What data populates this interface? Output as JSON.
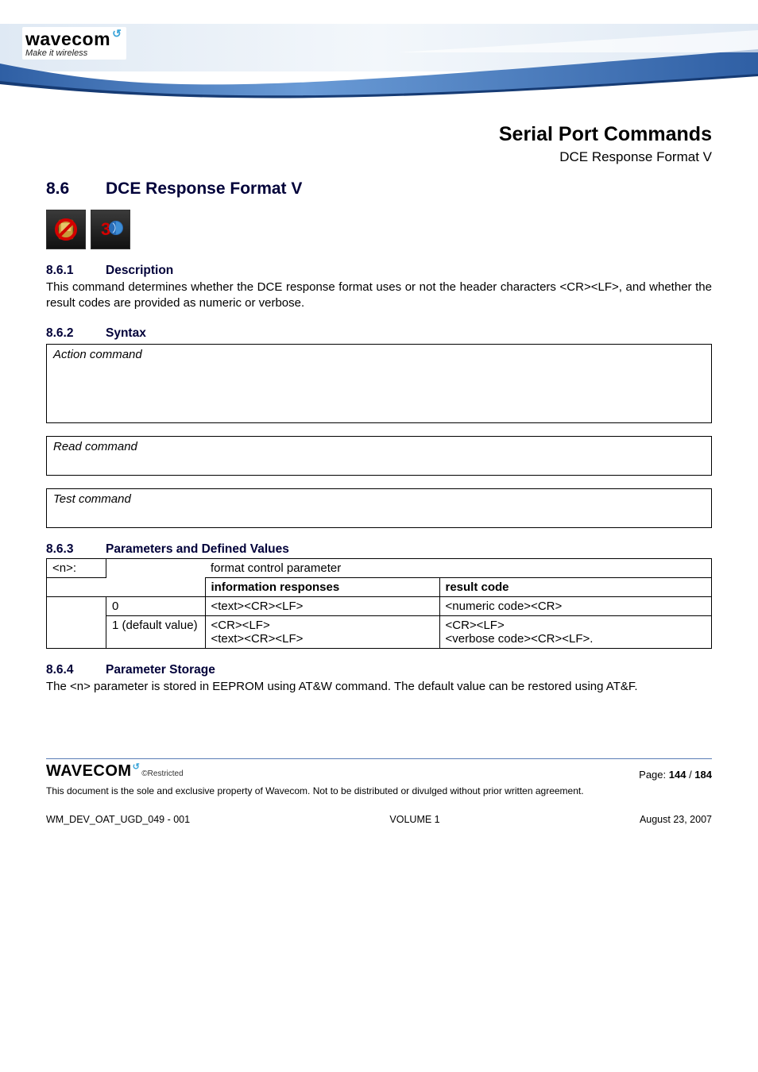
{
  "brand": {
    "name": "wavecom",
    "tagline": "Make it wireless",
    "swirl": "↺"
  },
  "header": {
    "title": "Serial Port Commands",
    "subtitle": "DCE Response Format V"
  },
  "section": {
    "num": "8.6",
    "title": "DCE Response Format V"
  },
  "icons": {
    "no_sim": "no-sim-icon",
    "three_g": "3g-icon"
  },
  "desc": {
    "num": "8.6.1",
    "title": "Description",
    "text": "This command determines whether the DCE response format uses or not the header characters <CR><LF>, and whether the result codes are provided as numeric or verbose."
  },
  "syntax": {
    "num": "8.6.2",
    "title": "Syntax",
    "action": "Action command",
    "read": "Read command",
    "test": "Test command"
  },
  "params": {
    "num": "8.6.3",
    "title": "Parameters and Defined Values",
    "name": "<n>:",
    "name_desc": "format control parameter",
    "col1": "information responses",
    "col2": "result code",
    "rows": [
      {
        "key": "0",
        "info": "<text><CR><LF>",
        "res": "<numeric code><CR>"
      },
      {
        "key": "1 (default value)",
        "info_l1": "<CR><LF>",
        "info_l2": "<text><CR><LF>",
        "res_l1": "<CR><LF>",
        "res_l2": "<verbose code><CR><LF>."
      }
    ]
  },
  "storage": {
    "num": "8.6.4",
    "title": "Parameter Storage",
    "text": "The <n> parameter is stored in EEPROM using AT&W command. The default value can be restored using AT&F."
  },
  "footer": {
    "brand": "WAVECOM",
    "restricted": "©Restricted",
    "page_label": "Page: ",
    "page_current": "144",
    "page_sep": " / ",
    "page_total": "184",
    "disclaimer": "This document is the sole and exclusive property of Wavecom. Not to be distributed or divulged without prior written agreement.",
    "doc_id": "WM_DEV_OAT_UGD_049 - 001",
    "volume": "VOLUME 1",
    "date": "August 23, 2007"
  }
}
